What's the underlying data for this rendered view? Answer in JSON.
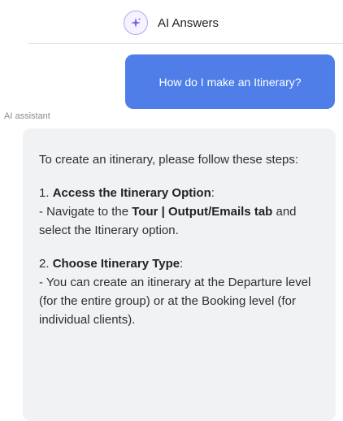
{
  "header": {
    "title": "AI Answers",
    "logo_icon": "sparkle-icon",
    "accent_color": "#7b61e8"
  },
  "chat": {
    "user_message": "How do I make an Itinerary?",
    "user_bubble_color": "#4f7ee8",
    "assistant_label": "AI assistant",
    "response": {
      "intro": "To create an itinerary, please follow these steps:",
      "step1": {
        "heading_num": "1. ",
        "heading": "Access the Itinerary Option",
        "heading_suffix": ":",
        "text_prefix": "- Navigate to the ",
        "text_bold": "Tour | Output/Emails tab",
        "text_suffix": " and select the Itinerary option."
      },
      "step2": {
        "heading_num": "2. ",
        "heading": "Choose Itinerary Type",
        "heading_suffix": ":",
        "text": "- You can create an itinerary at the Departure level (for the entire group) or at the Booking level (for individual clients)."
      }
    }
  }
}
